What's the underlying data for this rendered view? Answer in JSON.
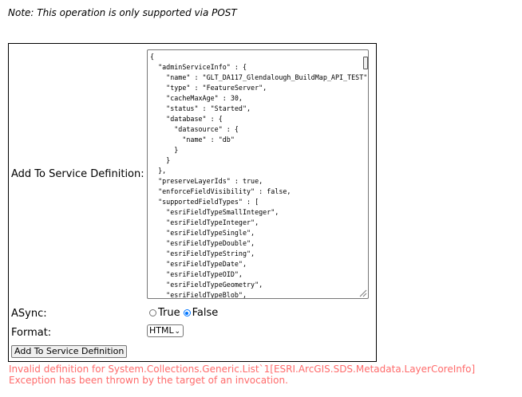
{
  "note": "Note: This operation is only supported via POST",
  "form": {
    "definition_label": "Add To Service Definition:",
    "definition_lines": [
      "{",
      "  \"adminServiceInfo\" : {",
      "    \"name\" : \"GLT_DA117_Glendalough_BuildMap_API_TEST\",",
      "    \"type\" : \"FeatureServer\",",
      "    \"cacheMaxAge\" : 30,",
      "    \"status\" : \"Started\",",
      "    \"database\" : {",
      "      \"datasource\" : {",
      "        \"name\" : \"db\"",
      "      }",
      "    }",
      "  },",
      "  \"preserveLayerIds\" : true,",
      "  \"enforceFieldVisibility\" : false,",
      "  \"supportedFieldTypes\" : [",
      "    \"esriFieldTypeSmallInteger\",",
      "    \"esriFieldTypeInteger\",",
      "    \"esriFieldTypeSingle\",",
      "    \"esriFieldTypeDouble\",",
      "    \"esriFieldTypeString\",",
      "    \"esriFieldTypeDate\",",
      "    \"esriFieldTypeOID\",",
      "    \"esriFieldTypeGeometry\",",
      "    \"esriFieldTypeBlob\","
    ],
    "async_label": "ASync:",
    "async_options": [
      "True",
      "False"
    ],
    "async_selected": "False",
    "format_label": "Format:",
    "format_value": "HTML",
    "submit_label": "Add To Service Definition"
  },
  "errors": [
    "Invalid definition for System.Collections.Generic.List`1[ESRI.ArcGIS.SDS.Metadata.LayerCoreInfo]",
    "Exception has been thrown by the target of an invocation."
  ],
  "colors": {
    "error": "#ff6b6b",
    "radio_checked": "#0075ff"
  }
}
